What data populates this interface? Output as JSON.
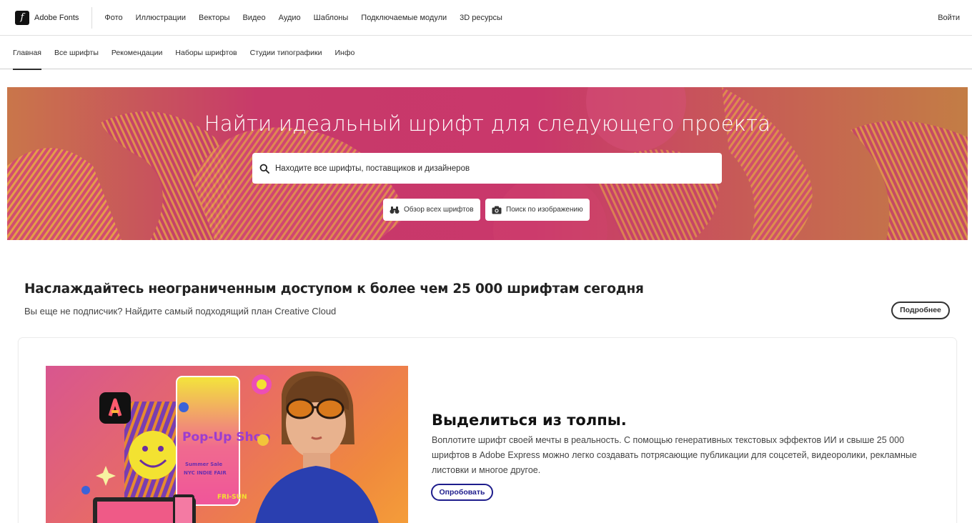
{
  "header": {
    "brand": "Adobe Fonts",
    "logo_letter": "f",
    "nav": [
      "Фото",
      "Иллюстрации",
      "Векторы",
      "Видео",
      "Аудио",
      "Шаблоны",
      "Подключаемые модули",
      "3D ресурсы"
    ],
    "signin": "Войти"
  },
  "subnav": {
    "items": [
      "Главная",
      "Все шрифты",
      "Рекомендации",
      "Наборы шрифтов",
      "Студии типографики",
      "Инфо"
    ],
    "active": "Главная"
  },
  "hero": {
    "title": "Найти идеальный шрифт для следующего проекта",
    "search_placeholder": "Находите все шрифты, поставщиков и дизайнеров",
    "browse_button": "Обзор всех шрифтов",
    "image_search_button": "Поиск по изображению"
  },
  "promo": {
    "title": "Наслаждайтесь неограниченным доступом к более чем 25 000 шрифтам сегодня",
    "subtitle": "Вы еще не подписчик? Найдите самый подходящий план Creative Cloud",
    "more_button": "Подробнее"
  },
  "card": {
    "title": "Выделиться из толпы.",
    "description": "Воплотите шрифт своей мечты в реальность. С помощью генеративных текстовых эффектов ИИ и свыше 25 000 шрифтов в Adobe Express можно легко создавать потрясающие публикации для соцсетей, видеоролики, рекламные листовки и многое другое.",
    "try_button": "Опробовать",
    "poster_title": "Pop-Up Shop",
    "poster_lines": [
      "Summer Sale",
      "NYC INDIE FAIR",
      "FRI-SUN"
    ]
  },
  "colors": {
    "hero_magenta": "#c9376b",
    "hero_orange": "#c9764a",
    "try_button": "#1e1d8c"
  },
  "icons": {
    "search": "search-icon",
    "browse": "binoculars-icon",
    "image_search": "camera-icon",
    "app": "adobe-express-icon"
  }
}
